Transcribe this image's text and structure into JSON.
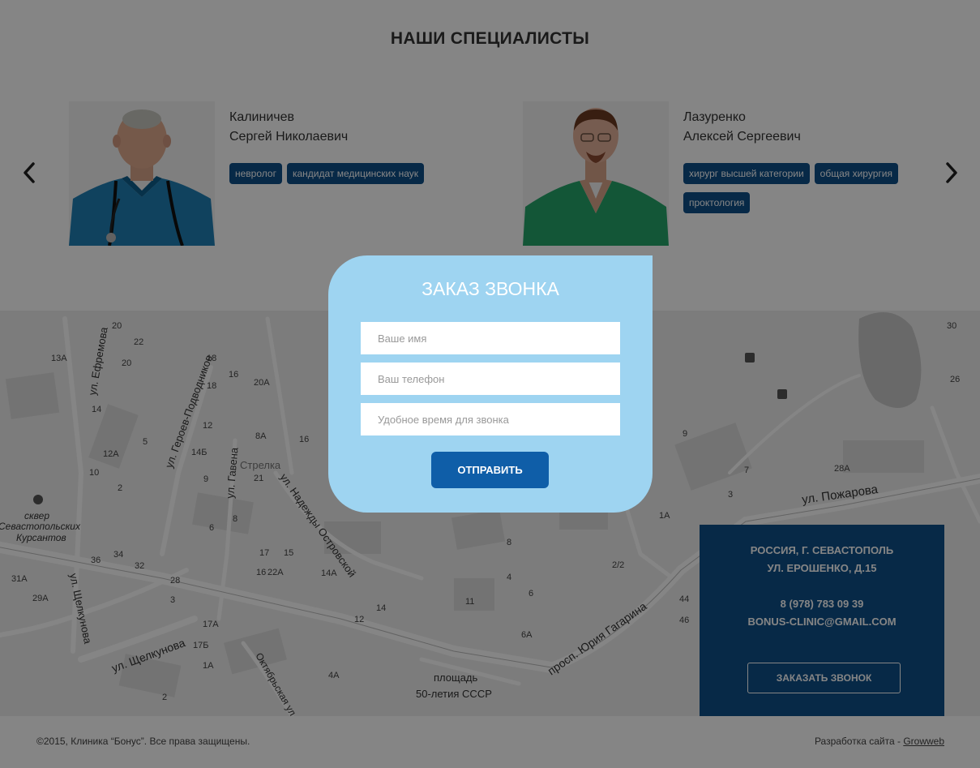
{
  "specialists": {
    "title": "НАШИ СПЕЦИАЛИСТЫ",
    "prev_icon": "chevron-left-icon",
    "next_icon": "chevron-right-icon",
    "doctors": [
      {
        "surname": "Калиничев",
        "name": "Сергей Николаевич",
        "tags": [
          "невролог",
          "кандидат медицинских наук"
        ]
      },
      {
        "surname": "Лазуренко",
        "name": "Алексей Сергеевич",
        "tags": [
          "хирург высшей категории",
          "общая хирургия",
          "проктология"
        ]
      }
    ]
  },
  "map": {
    "labels": [
      "ул. Ефремова",
      "ул. Героев-Подводников",
      "ул. Гавена",
      "ул. Надежды Островской",
      "ул. Пожарова",
      "ул. Щелкунова",
      "Октябрьская ул.",
      "просп. Юрия Гагарина",
      "площадь",
      "50-летия СССР",
      "сквер",
      "Севастопольских",
      "Курсантов",
      "Стрелка"
    ],
    "house_numbers": [
      "20",
      "22",
      "13А",
      "20",
      "18",
      "16",
      "18",
      "20А",
      "14",
      "8А",
      "12",
      "14Б",
      "16",
      "12А",
      "10",
      "5",
      "21",
      "9",
      "8",
      "2",
      "6",
      "17",
      "15",
      "16",
      "36",
      "34",
      "32",
      "28",
      "22А",
      "14А",
      "29А",
      "31А",
      "17А",
      "17Б",
      "1А",
      "4А",
      "2",
      "3",
      "11",
      "12",
      "14",
      "6А",
      "4",
      "6",
      "8",
      "2/2",
      "44",
      "46",
      "28А",
      "9",
      "3",
      "7",
      "1А",
      "30",
      "26"
    ]
  },
  "contact": {
    "address_line1": "РОССИЯ, Г. СЕВАСТОПОЛЬ",
    "address_line2": "УЛ. ЕРОШЕНКО, Д.15",
    "phone": "8 (978) 783 09 39",
    "email": "BONUS-CLINIC@GMAIL.COM",
    "button": "ЗАКАЗАТЬ ЗВОНОК"
  },
  "modal": {
    "title": "ЗАКАЗ ЗВОНКА",
    "name_placeholder": "Ваше имя",
    "phone_placeholder": "Ваш телефон",
    "time_placeholder": "Удобное время для звонка",
    "submit": "ОТПРАВИТЬ"
  },
  "footer": {
    "copyright": "©2015, Клиника “Бонус”. Все права защищены.",
    "dev_prefix": "Разработка сайта - ",
    "dev_link": "Growweb"
  },
  "colors": {
    "brand_blue": "#0f4f89",
    "button_blue": "#0f5ea8",
    "modal_bg": "#9ed4f1",
    "overlay": "rgba(0,0,0,0.48)"
  }
}
